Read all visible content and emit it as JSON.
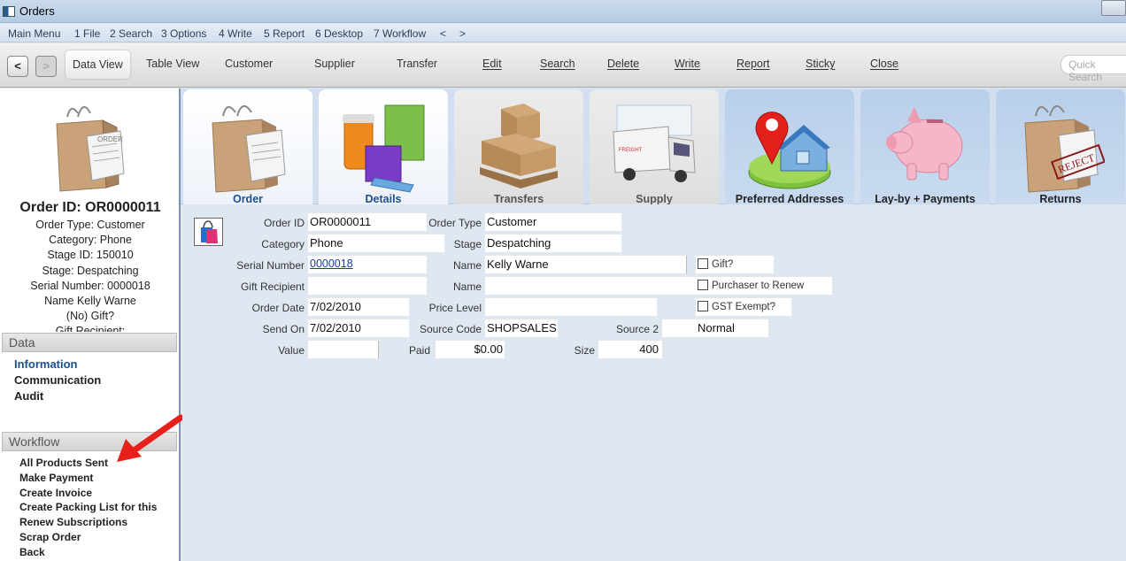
{
  "window": {
    "title": "Orders"
  },
  "menu": {
    "items": [
      "Main Menu",
      "1 File",
      "2 Search",
      "3 Options",
      "4 Write",
      "5 Report",
      "6 Desktop",
      "7 Workflow",
      "<",
      ">"
    ]
  },
  "toolbar": {
    "back": "<",
    "forward": ">",
    "buttons": [
      "Data View",
      "Table View",
      "Customer",
      "Supplier",
      "Transfer",
      "Edit",
      "Search",
      "Delete",
      "Write",
      "Report",
      "Sticky",
      "Close"
    ],
    "quick_search_placeholder": "Quick Search"
  },
  "summary": {
    "title": "Order ID: OR0000011",
    "lines": [
      "Order Type: Customer",
      "Category: Phone",
      "Stage ID: 150010",
      "Stage: Despatching",
      "Serial Number: 0000018",
      "Name Kelly Warne",
      "(No) Gift?",
      "Gift Recipient:"
    ]
  },
  "data_section": {
    "heading": "Data",
    "items": [
      "Information",
      "Communication",
      "Audit"
    ]
  },
  "workflow_section": {
    "heading": "Workflow",
    "items": [
      "All Products Sent",
      "Make Payment",
      "Create Invoice",
      "Create Packing List for this",
      "Renew Subscriptions",
      "Scrap Order",
      "Back"
    ]
  },
  "tabs": [
    "Order",
    "Details",
    "Transfers",
    "Supply",
    "Preferred Addresses",
    "Lay-by + Payments",
    "Returns"
  ],
  "form": {
    "order_id": {
      "label": "Order ID",
      "value": "OR0000011"
    },
    "order_type": {
      "label": "Order Type",
      "value": "Customer"
    },
    "category": {
      "label": "Category",
      "value": "Phone"
    },
    "stage": {
      "label": "Stage",
      "value": "Despatching"
    },
    "serial_number": {
      "label": "Serial Number",
      "value": "0000018"
    },
    "name": {
      "label": "Name",
      "value": "Kelly Warne"
    },
    "gift": {
      "label": "Gift?",
      "checked": false
    },
    "gift_recipient": {
      "label": "Gift Recipient",
      "value": ""
    },
    "name2": {
      "label": "Name",
      "value": ""
    },
    "purchaser_renew": {
      "label": "Purchaser to Renew",
      "checked": false
    },
    "order_date": {
      "label": "Order Date",
      "value": "7/02/2010"
    },
    "price_level": {
      "label": "Price Level",
      "value": ""
    },
    "gst_exempt": {
      "label": "GST Exempt?",
      "checked": false
    },
    "send_on": {
      "label": "Send On",
      "value": "7/02/2010"
    },
    "source_code": {
      "label": "Source Code",
      "value": "SHOPSALES"
    },
    "source2": {
      "label": "Source 2",
      "value": "Normal"
    },
    "value": {
      "label": "Value",
      "value": ""
    },
    "paid": {
      "label": "Paid",
      "value": "$0.00"
    },
    "size": {
      "label": "Size",
      "value": "400"
    }
  },
  "colors": {
    "accent": "#1a5090",
    "arrow": "#e8201c"
  }
}
